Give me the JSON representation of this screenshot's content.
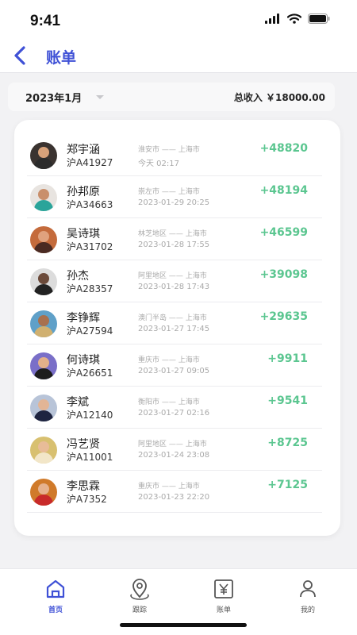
{
  "status": {
    "time": "9:41"
  },
  "nav": {
    "back_icon": "chevron-left-icon",
    "title": "账单"
  },
  "filter": {
    "month": "2023年1月",
    "total_income": "总收入 ￥18000.00"
  },
  "records": [
    {
      "name": "郑宇涵",
      "plate": "沪A41927",
      "route": "淮安市 —— 上海市",
      "time": "今天 02:17",
      "amount": "+48820",
      "avatar": {
        "bg": "#3a3330",
        "skin": "#d8a27a",
        "cloth": "#2b2b2b"
      }
    },
    {
      "name": "孙邦原",
      "plate": "沪A34663",
      "route": "崇左市 —— 上海市",
      "time": "2023-01-29 20:25",
      "amount": "+48194",
      "avatar": {
        "bg": "#e8e4e0",
        "skin": "#c98f6b",
        "cloth": "#2aa49a"
      }
    },
    {
      "name": "吴诗琪",
      "plate": "沪A31702",
      "route": "林芝地区 —— 上海市",
      "time": "2023-01-28 17:55",
      "amount": "+46599",
      "avatar": {
        "bg": "#c46b3c",
        "skin": "#e0a27e",
        "cloth": "#4a2a22"
      }
    },
    {
      "name": "孙杰",
      "plate": "沪A28357",
      "route": "阿里地区 —— 上海市",
      "time": "2023-01-28 17:43",
      "amount": "+39098",
      "avatar": {
        "bg": "#dcdcdc",
        "skin": "#6b4a3a",
        "cloth": "#222222"
      }
    },
    {
      "name": "李铮辉",
      "plate": "沪A27594",
      "route": "澳门半岛 —— 上海市",
      "time": "2023-01-27 17:45",
      "amount": "+29635",
      "avatar": {
        "bg": "#5fa0c8",
        "skin": "#a8704e",
        "cloth": "#d0b070"
      }
    },
    {
      "name": "何诗琪",
      "plate": "沪A26651",
      "route": "重庆市 —— 上海市",
      "time": "2023-01-27 09:05",
      "amount": "+9911",
      "avatar": {
        "bg": "#7a6fc8",
        "skin": "#e3b08a",
        "cloth": "#1d1d1d"
      }
    },
    {
      "name": "李斌",
      "plate": "沪A12140",
      "route": "衡阳市 —— 上海市",
      "time": "2023-01-27 02:16",
      "amount": "+9541",
      "avatar": {
        "bg": "#b8c4d8",
        "skin": "#e2b596",
        "cloth": "#1e2440"
      }
    },
    {
      "name": "冯艺贤",
      "plate": "沪A11001",
      "route": "阿里地区 —— 上海市",
      "time": "2023-01-24 23:08",
      "amount": "+8725",
      "avatar": {
        "bg": "#d8c070",
        "skin": "#e8bc98",
        "cloth": "#f2e6c8"
      }
    },
    {
      "name": "李思霖",
      "plate": "沪A7352",
      "route": "重庆市 —— 上海市",
      "time": "2023-01-23 22:20",
      "amount": "+7125",
      "avatar": {
        "bg": "#d07a2a",
        "skin": "#e6b28e",
        "cloth": "#c82a2a"
      }
    }
  ],
  "tabs": [
    {
      "id": "home",
      "label": "首页",
      "icon": "home-icon",
      "active": true
    },
    {
      "id": "track",
      "label": "跟踪",
      "icon": "location-pin-icon",
      "active": false
    },
    {
      "id": "bill",
      "label": "账单",
      "icon": "yen-receipt-icon",
      "active": false
    },
    {
      "id": "me",
      "label": "我的",
      "icon": "user-icon",
      "active": false
    }
  ],
  "colors": {
    "accent": "#3f51d6",
    "amount": "#5bc690"
  }
}
